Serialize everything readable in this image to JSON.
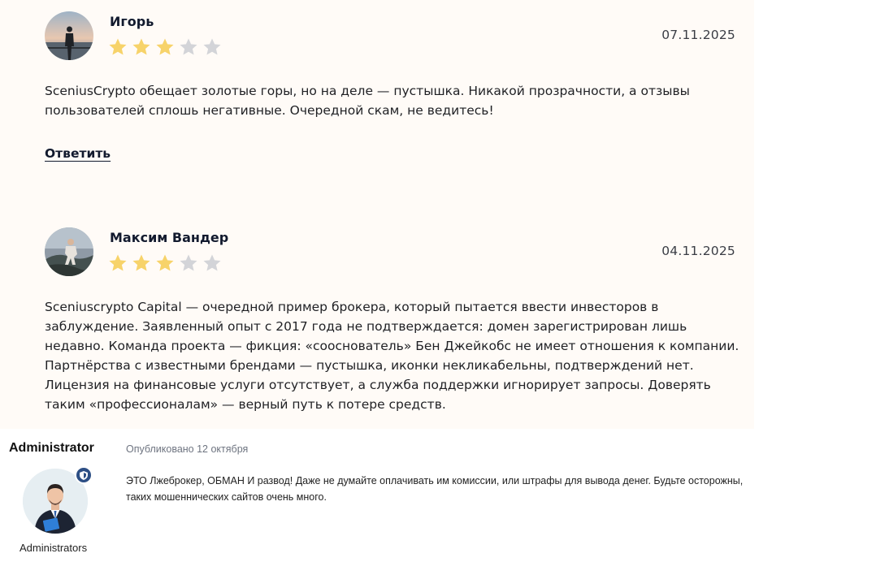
{
  "reviews": [
    {
      "author": "Игорь",
      "rating": 3,
      "rating_max": 5,
      "date": "07.11.2025",
      "text": "SceniusCrypto обещает золотые горы, но на деле — пустышка. Никакой прозрачности, а отзывы пользователей сплошь негативные. Очередной скам, не ведитесь!",
      "reply_label": "Ответить"
    },
    {
      "author": "Максим Вандер",
      "rating": 3,
      "rating_max": 5,
      "date": "04.11.2025",
      "text": "Sceniuscrypto Capital — очередной пример брокера, который пытается ввести инвесторов в заблуждение. Заявленный опыт с 2017 года не подтверждается: домен зарегистрирован лишь недавно. Команда проекта — фикция: «сооснователь» Бен Джейкобс не имеет отношения к компании. Партнёрства с известными брендами — пустышка, иконки некликабельны, подтверждений нет. Лицензия на финансовые услуги отсутствует, а служба поддержки игнорирует запросы. Доверять таким «профессионалам» — верный путь к потере средств."
    }
  ],
  "admin_post": {
    "name": "Administrator",
    "role": "Administrators",
    "published": "Опубликовано 12 октября",
    "text": "ЭТО Лжеброкер, ОБМАН И развод! Даже не думайте оплачивать им комиссии, или штрафы для вывода денег. Будьте осторожны, таких мошеннических сайтов очень много."
  },
  "colors": {
    "review_bg": "#fffbf7",
    "star_filled": "#f7d36a",
    "star_empty": "#d3d4d8",
    "badge": "#2d4f85"
  },
  "icons": {
    "star": "star-icon",
    "badge": "shield-icon"
  }
}
